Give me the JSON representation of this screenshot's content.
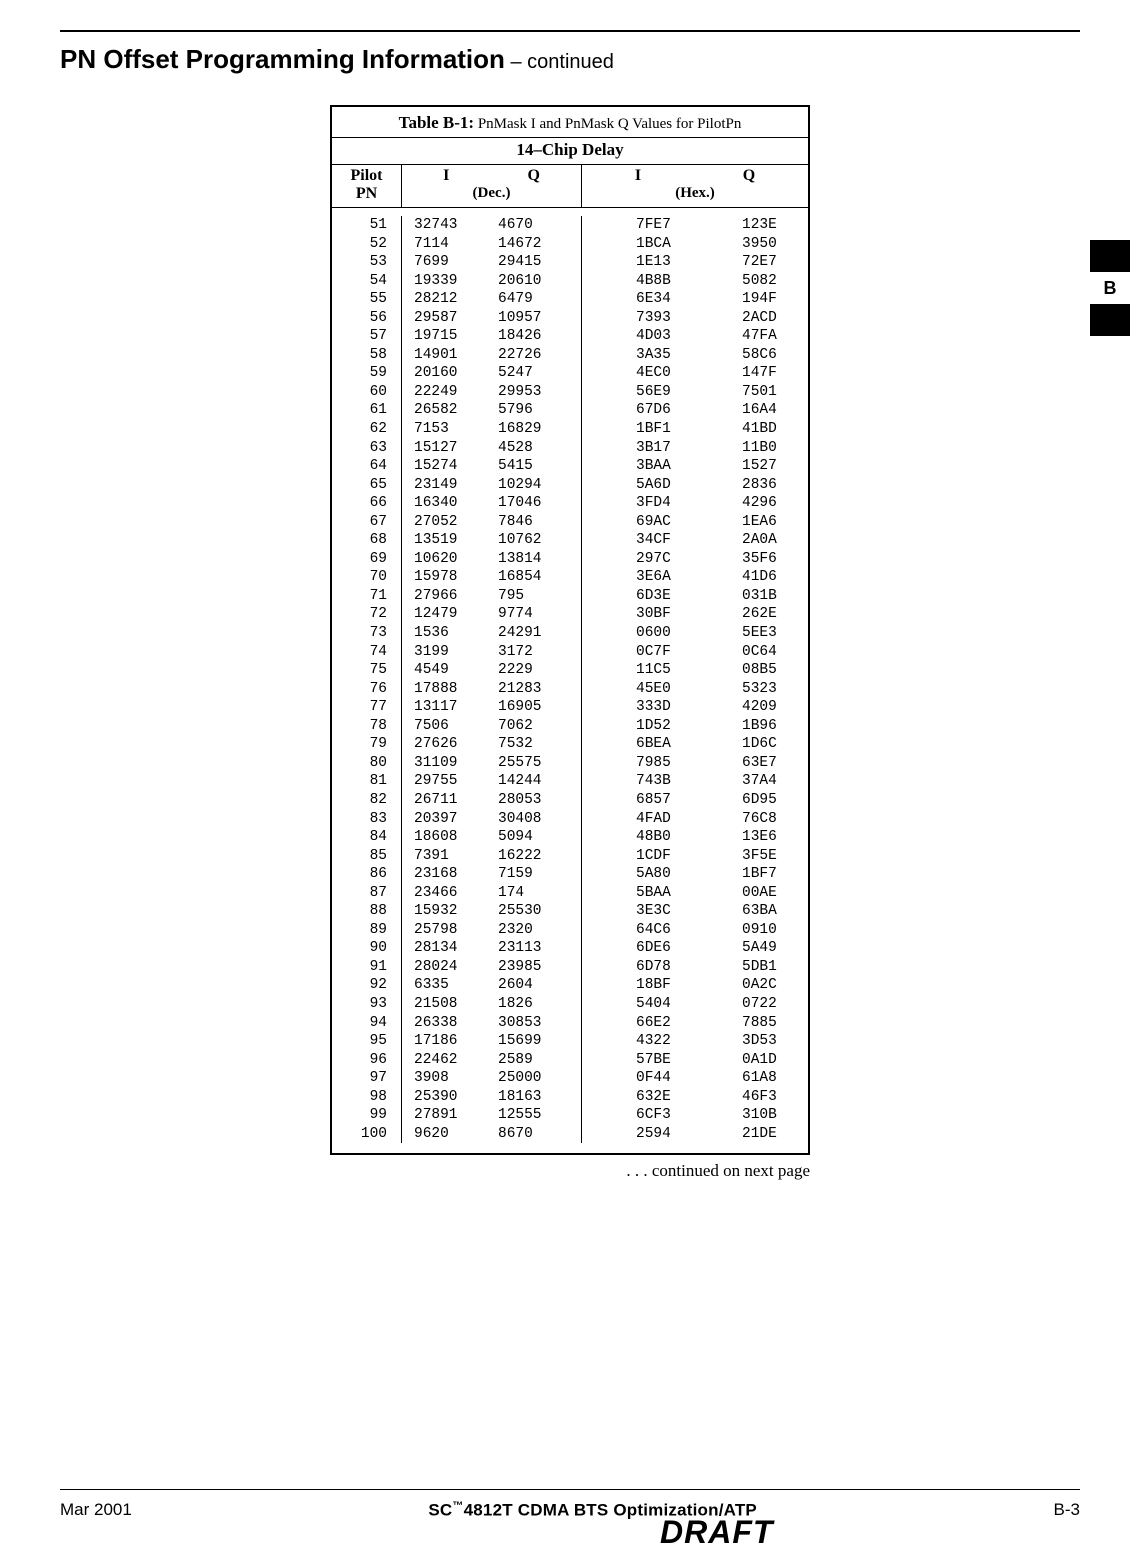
{
  "heading": {
    "title": "PN Offset Programming Information",
    "cont": " – continued"
  },
  "sideTab": {
    "label": "B"
  },
  "table": {
    "captionBold": "Table B-1:",
    "captionRest": " PnMask I and PnMask Q Values for PilotPn",
    "subcaption": "14–Chip  Delay",
    "colPilotLine1": "Pilot",
    "colPilotLine2": "PN",
    "colI": "I",
    "colQ": "Q",
    "colDec": "(Dec.)",
    "colHex": "(Hex.)"
  },
  "continued": ". . . continued on next page",
  "footer": {
    "left": "Mar 2001",
    "centerPrefix": "SC",
    "centerTM": "™",
    "centerRest": "4812T CDMA BTS Optimization/ATP",
    "right": "B-3",
    "draft": "DRAFT"
  },
  "chart_data": {
    "type": "table",
    "title": "Table B-1: PnMask I and PnMask Q Values for PilotPn — 14-Chip Delay",
    "columns": [
      "Pilot PN",
      "I (Dec.)",
      "Q (Dec.)",
      "I (Hex.)",
      "Q (Hex.)"
    ],
    "rows": [
      [
        51,
        32743,
        4670,
        "7FE7",
        "123E"
      ],
      [
        52,
        7114,
        14672,
        "1BCA",
        "3950"
      ],
      [
        53,
        7699,
        29415,
        "1E13",
        "72E7"
      ],
      [
        54,
        19339,
        20610,
        "4B8B",
        "5082"
      ],
      [
        55,
        28212,
        6479,
        "6E34",
        "194F"
      ],
      [
        56,
        29587,
        10957,
        "7393",
        "2ACD"
      ],
      [
        57,
        19715,
        18426,
        "4D03",
        "47FA"
      ],
      [
        58,
        14901,
        22726,
        "3A35",
        "58C6"
      ],
      [
        59,
        20160,
        5247,
        "4EC0",
        "147F"
      ],
      [
        60,
        22249,
        29953,
        "56E9",
        "7501"
      ],
      [
        61,
        26582,
        5796,
        "67D6",
        "16A4"
      ],
      [
        62,
        7153,
        16829,
        "1BF1",
        "41BD"
      ],
      [
        63,
        15127,
        4528,
        "3B17",
        "11B0"
      ],
      [
        64,
        15274,
        5415,
        "3BAA",
        "1527"
      ],
      [
        65,
        23149,
        10294,
        "5A6D",
        "2836"
      ],
      [
        66,
        16340,
        17046,
        "3FD4",
        "4296"
      ],
      [
        67,
        27052,
        7846,
        "69AC",
        "1EA6"
      ],
      [
        68,
        13519,
        10762,
        "34CF",
        "2A0A"
      ],
      [
        69,
        10620,
        13814,
        "297C",
        "35F6"
      ],
      [
        70,
        15978,
        16854,
        "3E6A",
        "41D6"
      ],
      [
        71,
        27966,
        795,
        "6D3E",
        "031B"
      ],
      [
        72,
        12479,
        9774,
        "30BF",
        "262E"
      ],
      [
        73,
        1536,
        24291,
        "0600",
        "5EE3"
      ],
      [
        74,
        3199,
        3172,
        "0C7F",
        "0C64"
      ],
      [
        75,
        4549,
        2229,
        "11C5",
        "08B5"
      ],
      [
        76,
        17888,
        21283,
        "45E0",
        "5323"
      ],
      [
        77,
        13117,
        16905,
        "333D",
        "4209"
      ],
      [
        78,
        7506,
        7062,
        "1D52",
        "1B96"
      ],
      [
        79,
        27626,
        7532,
        "6BEA",
        "1D6C"
      ],
      [
        80,
        31109,
        25575,
        "7985",
        "63E7"
      ],
      [
        81,
        29755,
        14244,
        "743B",
        "37A4"
      ],
      [
        82,
        26711,
        28053,
        "6857",
        "6D95"
      ],
      [
        83,
        20397,
        30408,
        "4FAD",
        "76C8"
      ],
      [
        84,
        18608,
        5094,
        "48B0",
        "13E6"
      ],
      [
        85,
        7391,
        16222,
        "1CDF",
        "3F5E"
      ],
      [
        86,
        23168,
        7159,
        "5A80",
        "1BF7"
      ],
      [
        87,
        23466,
        174,
        "5BAA",
        "00AE"
      ],
      [
        88,
        15932,
        25530,
        "3E3C",
        "63BA"
      ],
      [
        89,
        25798,
        2320,
        "64C6",
        "0910"
      ],
      [
        90,
        28134,
        23113,
        "6DE6",
        "5A49"
      ],
      [
        91,
        28024,
        23985,
        "6D78",
        "5DB1"
      ],
      [
        92,
        6335,
        2604,
        "18BF",
        "0A2C"
      ],
      [
        93,
        21508,
        1826,
        "5404",
        "0722"
      ],
      [
        94,
        26338,
        30853,
        "66E2",
        "7885"
      ],
      [
        95,
        17186,
        15699,
        "4322",
        "3D53"
      ],
      [
        96,
        22462,
        2589,
        "57BE",
        "0A1D"
      ],
      [
        97,
        3908,
        25000,
        "0F44",
        "61A8"
      ],
      [
        98,
        25390,
        18163,
        "632E",
        "46F3"
      ],
      [
        99,
        27891,
        12555,
        "6CF3",
        "310B"
      ],
      [
        100,
        9620,
        8670,
        "2594",
        "21DE"
      ]
    ]
  }
}
